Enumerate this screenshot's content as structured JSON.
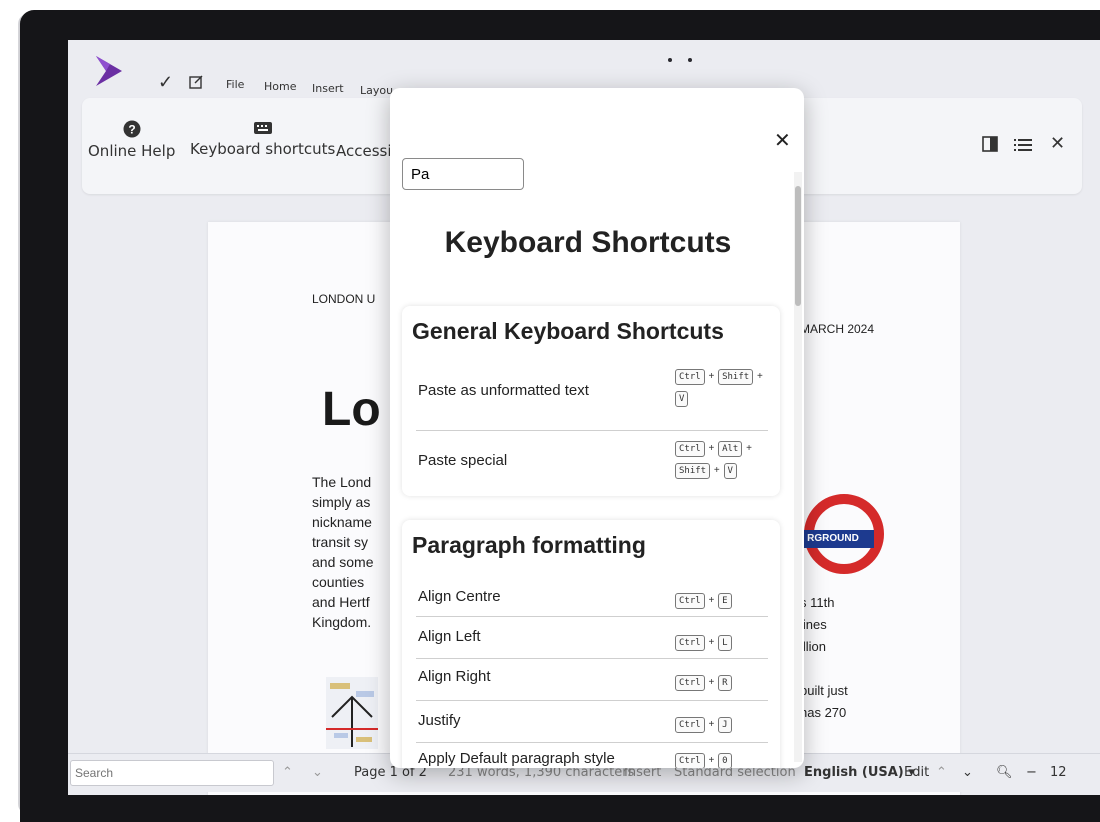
{
  "menu": {
    "file": "File",
    "home": "Home",
    "insert": "Insert",
    "layout": "Layou"
  },
  "ribbon": {
    "online_help": "Online Help",
    "keyboard_shortcuts": "Keyboard shortcuts",
    "accessibility": "Accessib"
  },
  "doc": {
    "header_left": "LONDON U",
    "header_right": "MARCH 2024",
    "title": "Lo",
    "body_left": [
      "The Lond",
      "simply as",
      "nickname",
      "transit sy",
      "and some",
      "counties",
      "and Hertf",
      "Kingdom."
    ],
    "body_right": [
      "s 11th",
      "lines",
      "illion",
      "",
      "built just",
      "has 270"
    ],
    "roundel_text": "RGROUND"
  },
  "status": {
    "search_placeholder": "Search",
    "page": "Page 1 of 2",
    "stats": "231 words, 1,390 characters",
    "insert": "Insert",
    "selection": "Standard selection",
    "language": "English (USA)",
    "edit": "Edit",
    "zoom": "12"
  },
  "dialog": {
    "search_value": "Pa",
    "title": "Keyboard Shortcuts",
    "sections": [
      {
        "heading": "General Keyboard Shortcuts",
        "items": [
          {
            "label": "Paste as unformatted text",
            "keys": [
              "Ctrl",
              "Shift",
              "V"
            ]
          },
          {
            "label": "Paste special",
            "keys": [
              "Ctrl",
              "Alt",
              "Shift",
              "V"
            ]
          }
        ]
      },
      {
        "heading": "Paragraph formatting",
        "items": [
          {
            "label": "Align Centre",
            "keys": [
              "Ctrl",
              "E"
            ]
          },
          {
            "label": "Align Left",
            "keys": [
              "Ctrl",
              "L"
            ]
          },
          {
            "label": "Align Right",
            "keys": [
              "Ctrl",
              "R"
            ]
          },
          {
            "label": "Justify",
            "keys": [
              "Ctrl",
              "J"
            ]
          },
          {
            "label": "Apply Default paragraph style",
            "keys": [
              "Ctrl",
              "0"
            ]
          }
        ]
      }
    ]
  },
  "colors": {
    "accent": "#6b2fa3",
    "roundel_red": "#d52a2a",
    "roundel_blue": "#1d3a8f"
  }
}
